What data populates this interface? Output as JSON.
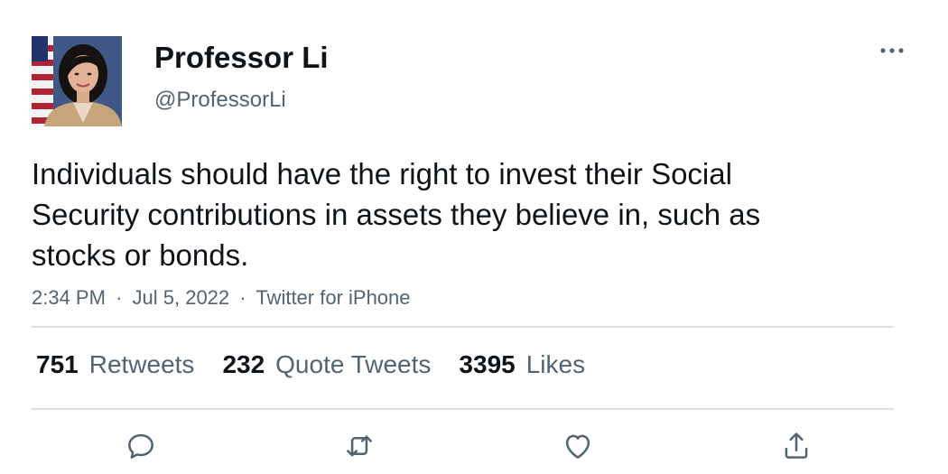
{
  "author": {
    "display_name": "Professor Li",
    "handle": "@ProfessorLi",
    "avatar_icon": "profile-photo"
  },
  "tweet": {
    "text": "Individuals should have the right to invest their Social Security contributions in assets they believe in, such as stocks or bonds.",
    "time": "2:34 PM",
    "separator": "·",
    "date": "Jul 5, 2022",
    "source": "Twitter for iPhone"
  },
  "stats": {
    "retweets": {
      "count": "751",
      "label": "Retweets"
    },
    "quote_tweets": {
      "count": "232",
      "label": "Quote Tweets"
    },
    "likes": {
      "count": "3395",
      "label": "Likes"
    }
  },
  "actions": [
    "reply-icon",
    "retweet-icon",
    "like-icon",
    "share-icon"
  ],
  "colors": {
    "text_primary": "#0f1419",
    "text_secondary": "#536471",
    "divider": "#dcdfe2",
    "icon": "#536471"
  }
}
